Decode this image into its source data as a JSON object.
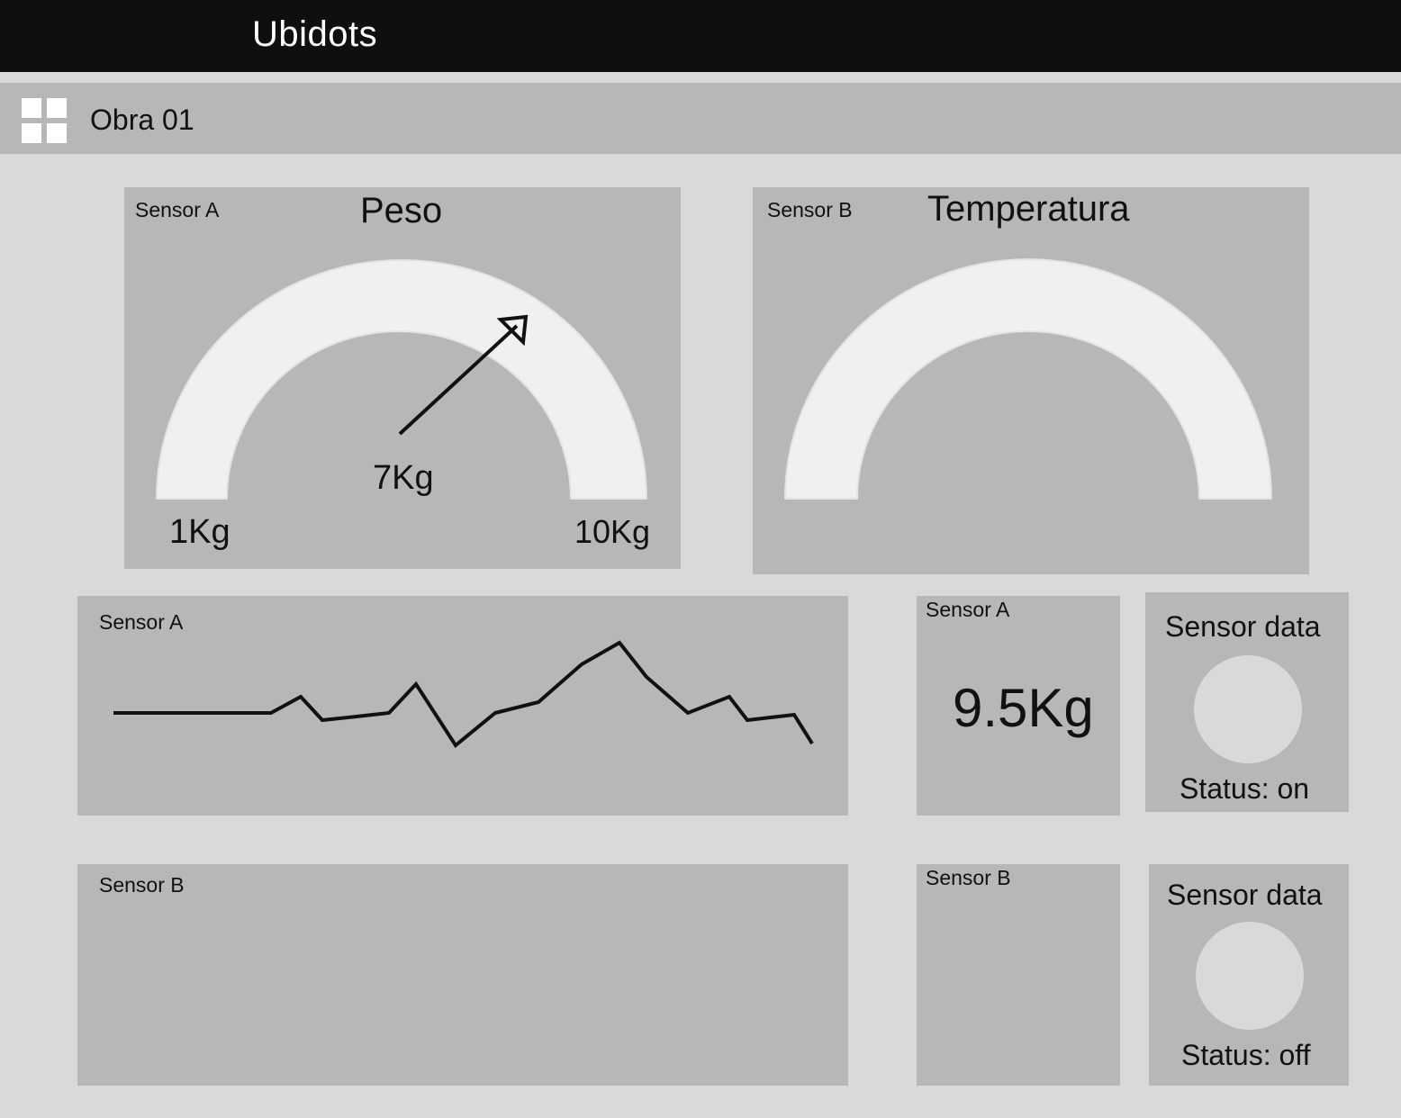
{
  "header": {
    "app_title": "Ubidots"
  },
  "dashboard": {
    "name": "Obra 01",
    "icon": "grid-icon"
  },
  "widgets": {
    "gauge_a": {
      "sensor": "Sensor A",
      "title": "Peso",
      "value_label": "7Kg",
      "min_label": "1Kg",
      "max_label": "10Kg",
      "value": 7,
      "min": 1,
      "max": 10
    },
    "gauge_b": {
      "sensor": "Sensor B",
      "title": "Temperatura"
    },
    "line_a": {
      "sensor": "Sensor A"
    },
    "line_b": {
      "sensor": "Sensor B"
    },
    "metric_a": {
      "sensor": "Sensor A",
      "value": "9.5Kg"
    },
    "metric_b": {
      "sensor": "Sensor B"
    },
    "status_a": {
      "title": "Sensor data",
      "status": "Status: on"
    },
    "status_b": {
      "title": "Sensor data",
      "status": "Status: off"
    }
  },
  "chart_data": {
    "type": "line",
    "series": [
      {
        "values": [
          3.0,
          3.0,
          3.0,
          3.0,
          3.0,
          3.9,
          2.6,
          2.8,
          3.0,
          4.6,
          1.2,
          3.0,
          3.6,
          5.7,
          6.9,
          5.0,
          3.0,
          3.9,
          2.6,
          2.9,
          1.3
        ]
      }
    ]
  }
}
